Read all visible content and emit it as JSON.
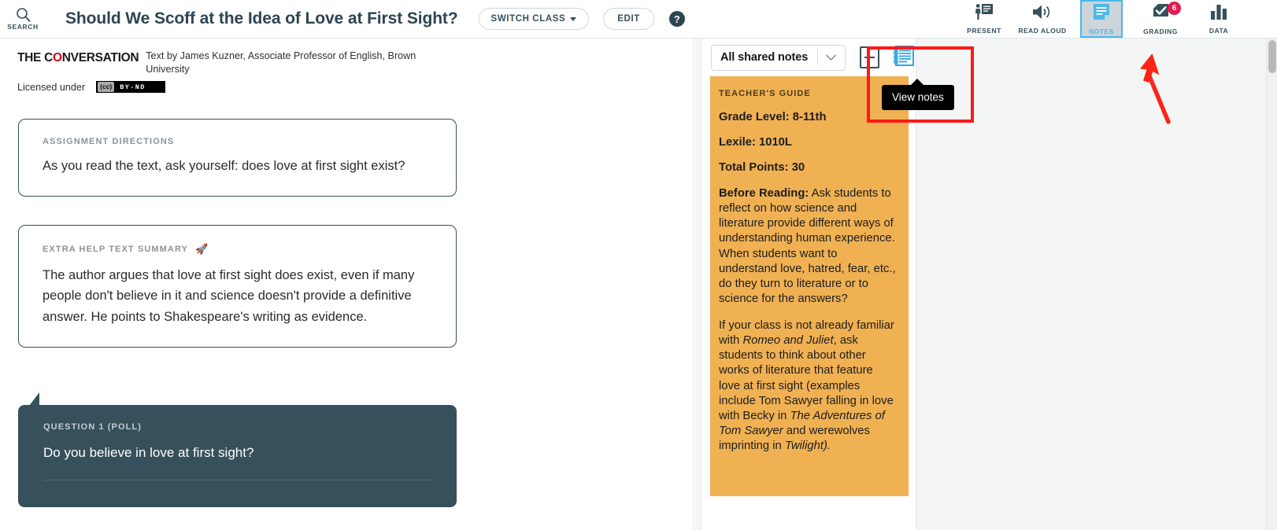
{
  "topbar": {
    "search_label": "SEARCH",
    "title": "Should We Scoff at the Idea of Love at First Sight?",
    "switch_class_label": "SWITCH CLASS",
    "edit_label": "EDIT",
    "help_label": "?",
    "tabs": [
      {
        "id": "present",
        "label": "PRESENT",
        "icon": "presenter-board-icon",
        "active": false,
        "badge": null
      },
      {
        "id": "read-aloud",
        "label": "READ ALOUD",
        "icon": "speaker-volume-icon",
        "active": false,
        "badge": null
      },
      {
        "id": "notes",
        "label": "NOTES",
        "icon": "note-page-icon",
        "active": true,
        "badge": null
      },
      {
        "id": "grading",
        "label": "GRADING",
        "icon": "checkmark-flag-icon",
        "active": false,
        "badge": "6"
      },
      {
        "id": "data",
        "label": "DATA",
        "icon": "bar-chart-icon",
        "active": false,
        "badge": null
      }
    ]
  },
  "source": {
    "logo_part1": "THE C",
    "logo_o": "O",
    "logo_part2": "NVERSATION",
    "byline": "Text by James Kuzner, Associate Professor of English, Brown University",
    "license_label": "Licensed under",
    "license_cc": "(cc)",
    "license_type": "BY-ND"
  },
  "cards": {
    "directions": {
      "kicker": "ASSIGNMENT DIRECTIONS",
      "body": "As you read the text, ask yourself: does love at first sight exist?"
    },
    "summary": {
      "kicker": "EXTRA HELP TEXT SUMMARY",
      "icon": "rocket-icon",
      "body": "The author argues that love at first sight does exist, even if many people don't believe in it and science doesn't provide a definitive answer. He points to Shakespeare's writing as evidence."
    },
    "poll": {
      "kicker": "QUESTION 1 (POLL)",
      "question": "Do you believe in love at first sight?"
    }
  },
  "notes_panel": {
    "filter_value": "All shared notes",
    "collapse_icon": "minus-collapse-icon",
    "view_notes_icon": "notebook-icon",
    "tooltip": "View notes",
    "guide": {
      "kicker": "TEACHER'S GUIDE",
      "grade_level": "Grade Level: 8-11th",
      "lexile": "Lexile: 1010L",
      "total_points": "Total Points: 30",
      "before_reading_label": "Before Reading:",
      "before_reading_text": " Ask students to reflect on how science and literature provide different ways of understanding human experience. When students want to understand love, hatred, fear, etc., do they turn to literature or to science for the answers?",
      "para2_a": "If your class is not already familiar with ",
      "para2_italic1": "Romeo and Juliet",
      "para2_b": ", ask students to think about other works of literature that feature love at first sight (examples include Tom Sawyer falling in love with Becky in ",
      "para2_italic2": "The Adventures of Tom Sawyer",
      "para2_c": " and werewolves imprinting in ",
      "para2_italic3": "Twilight)."
    }
  },
  "annotations": {
    "highlight_box_color": "#fc1a17",
    "arrow_color": "#fc2418",
    "accent_blue": "#4cb7ea",
    "badge_color": "#e8174f",
    "guide_bg": "#f0b153",
    "dark_card_bg": "#36505c"
  }
}
